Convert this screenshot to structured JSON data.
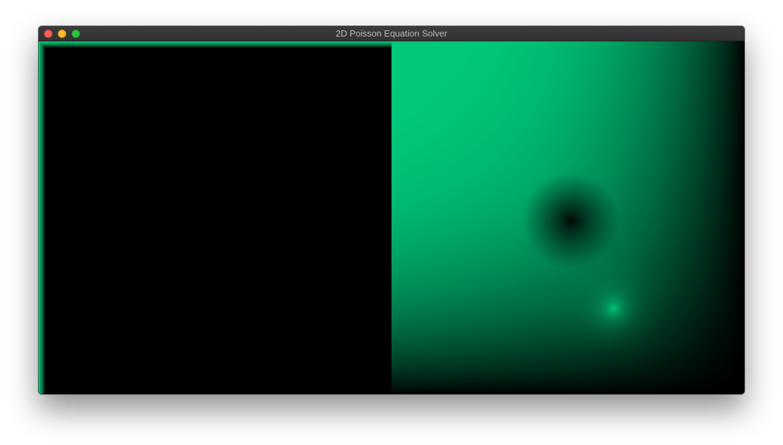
{
  "window": {
    "title": "2D Poisson Equation Solver"
  },
  "traffic_lights": {
    "close_color": "#ff5f57",
    "minimize_color": "#febc2e",
    "zoom_color": "#28c840"
  },
  "colors": {
    "field_color": "#00c97a",
    "background": "#000000"
  },
  "panels": [
    {
      "name": "source-field-view"
    },
    {
      "name": "solution-field-view"
    }
  ]
}
